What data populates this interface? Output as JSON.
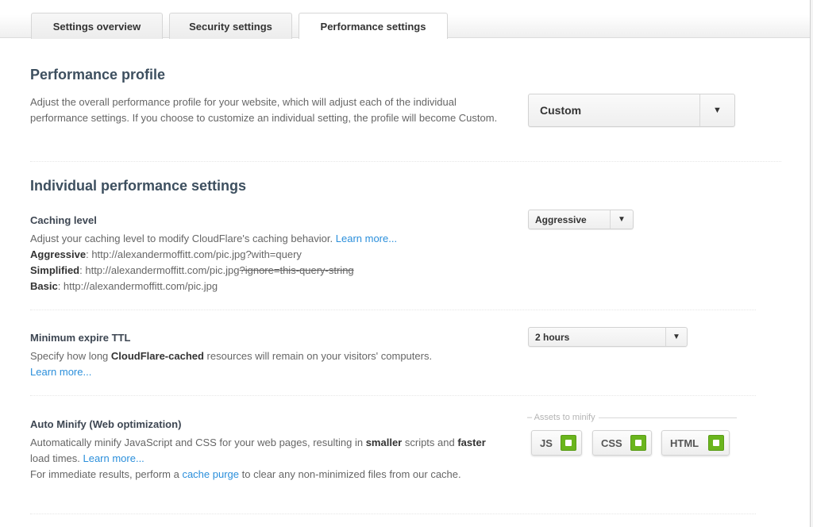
{
  "tabs": [
    {
      "label": "Settings overview",
      "active": false
    },
    {
      "label": "Security settings",
      "active": false
    },
    {
      "label": "Performance settings",
      "active": true
    }
  ],
  "profile": {
    "heading": "Performance profile",
    "description": "Adjust the overall performance profile for your website, which will adjust each of the individual performance settings. If you choose to customize an individual setting, the profile will become Custom.",
    "select_value": "Custom",
    "arrow": "▼"
  },
  "individual": {
    "heading": "Individual performance settings"
  },
  "caching": {
    "title": "Caching level",
    "desc": "Adjust your caching level to modify CloudFlare's caching behavior. ",
    "learn_more": "Learn more...",
    "aggressive_label": "Aggressive",
    "aggressive_url": ": http://alexandermoffitt.com/pic.jpg?with=query",
    "simplified_label": "Simplified",
    "simplified_url": ": http://alexandermoffitt.com/pic.jpg",
    "simplified_struck": "?ignore=this-query-string",
    "basic_label": "Basic",
    "basic_url": ": http://alexandermoffitt.com/pic.jpg",
    "select_value": "Aggressive",
    "arrow": "▼"
  },
  "ttl": {
    "title": "Minimum expire TTL",
    "desc_pre": "Specify how long ",
    "desc_bold": "CloudFlare-cached",
    "desc_post": " resources will remain on your visitors' computers.",
    "learn_more": "Learn more...",
    "select_value": "2 hours",
    "arrow": "▼"
  },
  "minify": {
    "title": "Auto Minify (Web optimization)",
    "desc_1": "Automatically minify JavaScript and CSS for your web pages, resulting in ",
    "bold_1": "smaller",
    "desc_2": " scripts and ",
    "bold_2": "faster",
    "desc_3": " load times. ",
    "learn_more": "Learn more...",
    "desc_4": "For immediate results, perform a ",
    "cache_purge": "cache purge",
    "desc_5": " to clear any non-minimized files from our cache.",
    "legend": "– Assets to minify",
    "assets": [
      {
        "label": "JS",
        "enabled": true
      },
      {
        "label": "CSS",
        "enabled": true
      },
      {
        "label": "HTML",
        "enabled": true
      }
    ],
    "toggle_color": "#6ab51d"
  }
}
